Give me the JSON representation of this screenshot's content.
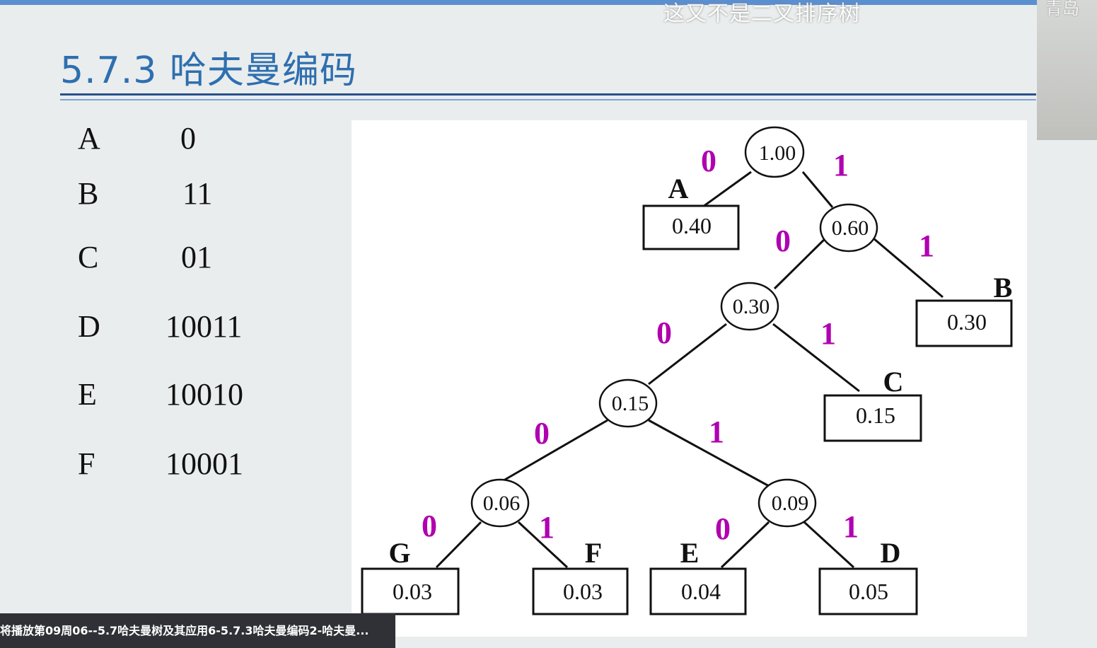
{
  "overlay": {
    "subtitle": "这又不是二叉排序树",
    "webcam_label": "青岛"
  },
  "slide": {
    "title": "5.7.3 哈夫曼编码",
    "codes": [
      {
        "letter": "A",
        "code": "0"
      },
      {
        "letter": "B",
        "code": "11"
      },
      {
        "letter": "C",
        "code": "01"
      },
      {
        "letter": "D",
        "code": "10011"
      },
      {
        "letter": "E",
        "code": "10010"
      },
      {
        "letter": "F",
        "code": "10001"
      }
    ],
    "tree": {
      "internal_nodes": [
        "1.00",
        "0.60",
        "0.30",
        "0.15",
        "0.06",
        "0.09"
      ],
      "leaves": [
        {
          "label": "A",
          "value": "0.40"
        },
        {
          "label": "B",
          "value": "0.30"
        },
        {
          "label": "C",
          "value": "0.15"
        },
        {
          "label": "G",
          "value": "0.03"
        },
        {
          "label": "F",
          "value": "0.03"
        },
        {
          "label": "E",
          "value": "0.04"
        },
        {
          "label": "D",
          "value": "0.05"
        }
      ],
      "edge_bits": [
        "0",
        "1",
        "0",
        "1",
        "0",
        "1",
        "0",
        "1",
        "0",
        "1",
        "0",
        "1"
      ]
    }
  },
  "player": {
    "video_title": "将播放第09周06--5.7哈夫曼树及其应用6-5.7.3哈夫曼编码2-哈夫曼..."
  },
  "colors": {
    "accent": "#2e6fb0",
    "bit": "#b000b0",
    "top_bar": "#5b8fd0"
  }
}
